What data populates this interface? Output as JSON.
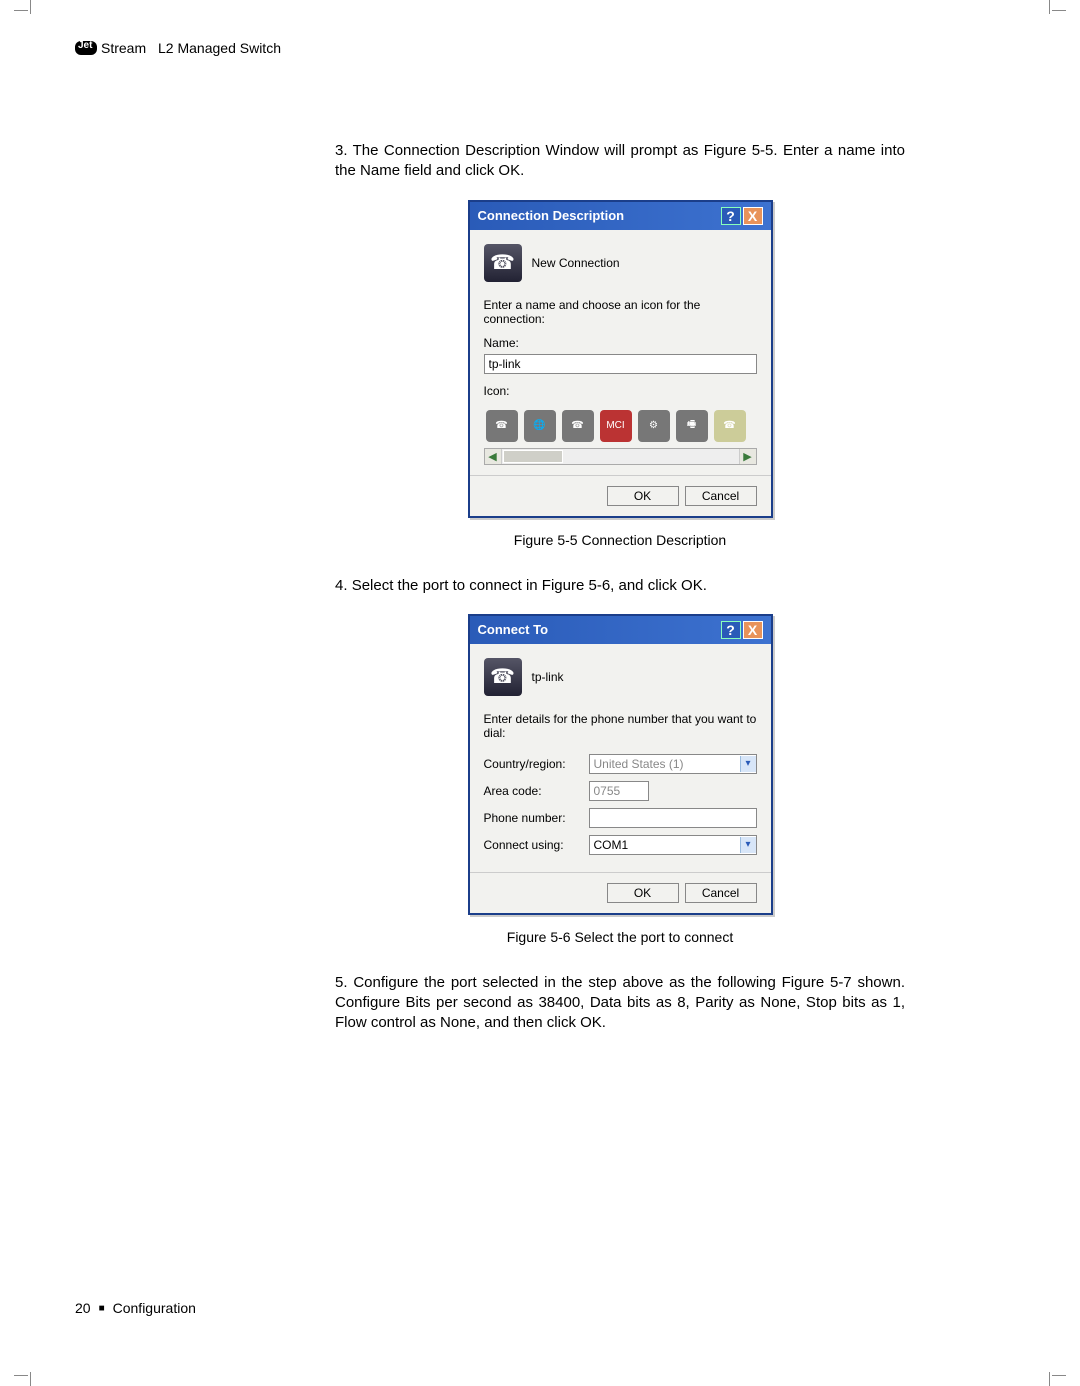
{
  "header": {
    "brand_suffix": "Stream",
    "product": "L2 Managed Switch"
  },
  "steps": {
    "s3_num": "3.",
    "s3_text": "The Connection Description Window will prompt as Figure 5-5. Enter a name into the Name field and click OK.",
    "s4_num": "4.",
    "s4_text": "Select the port to connect in Figure 5-6, and click OK.",
    "s5_num": "5.",
    "s5_text": "Configure the port selected in the step above as the following Figure 5-7 shown. Configure Bits per second as 38400, Data bits as 8, Parity as None, Stop bits as 1, Flow control as None, and then click OK."
  },
  "captions": {
    "fig55": "Figure 5-5  Connection Description",
    "fig56": "Figure 5-6  Select the port to connect"
  },
  "dlg1": {
    "title": "Connection Description",
    "heading": "New Connection",
    "instr": "Enter a name and choose an icon for the connection:",
    "name_label": "Name:",
    "name_value": "tp-link",
    "icon_label": "Icon:",
    "ok": "OK",
    "cancel": "Cancel",
    "help": "?",
    "close": "X",
    "icon_mci": "MCI"
  },
  "dlg2": {
    "title": "Connect To",
    "heading": "tp-link",
    "instr": "Enter details for the phone number that you want to dial:",
    "country_label": "Country/region:",
    "country_value": "United States (1)",
    "area_label": "Area code:",
    "area_value": "0755",
    "phone_label": "Phone number:",
    "phone_value": "",
    "connect_label": "Connect using:",
    "connect_value": "COM1",
    "ok": "OK",
    "cancel": "Cancel",
    "help": "?",
    "close": "X"
  },
  "footer": {
    "page": "20",
    "section": "Configuration"
  }
}
